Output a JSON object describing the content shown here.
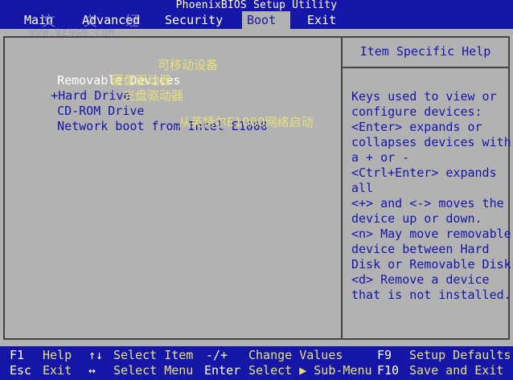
{
  "title": "PhoenixBIOS Setup Utility",
  "menu": {
    "main": "Main",
    "advanced": "Advanced",
    "security": "Security",
    "boot": "Boot",
    "exit": "Exit"
  },
  "watermark": {
    "logo": "文  文  经",
    "url": "WWW.WENGB.COM"
  },
  "boot_list": [
    {
      "label": "Removable Devices",
      "prefix": "",
      "annotation": "可移动设备",
      "selected": true
    },
    {
      "label": "Hard Drive",
      "prefix": "+",
      "annotation": "硬盘驱动器",
      "selected": false
    },
    {
      "label": "CD-ROM Drive",
      "prefix": "",
      "annotation": "光盘驱动器",
      "selected": false
    },
    {
      "label": "Network boot from Intel E1000",
      "prefix": "",
      "annotation": "从英特尔E1000网络启动",
      "selected": false
    }
  ],
  "help": {
    "title": "Item Specific Help",
    "lines": [
      "Keys used to view or",
      "configure devices:",
      "<Enter> expands or",
      "collapses devices with",
      "a + or -",
      "<Ctrl+Enter> expands",
      "all",
      "<+> and <-> moves the",
      "device up or down.",
      "<n> May move removable",
      "device between Hard",
      "Disk or Removable Disk",
      "<d> Remove a device",
      "that is not installed."
    ]
  },
  "footer": {
    "f1_key": "F1",
    "f1_desc": "Help",
    "arrows_ud_key": "↑↓",
    "arrows_ud_desc": "Select Item",
    "minus_plus_key": "-/+",
    "minus_plus_desc": "Change Values",
    "f9_key": "F9",
    "f9_desc": "Setup Defaults",
    "esc_key": "Esc",
    "esc_desc": "Exit",
    "arrows_lr_key": "↔",
    "arrows_lr_desc": "Select Menu",
    "enter_key": "Enter",
    "enter_desc": "Select ▶ Sub-Menu",
    "f10_key": "F10",
    "f10_desc": "Save and Exit"
  }
}
